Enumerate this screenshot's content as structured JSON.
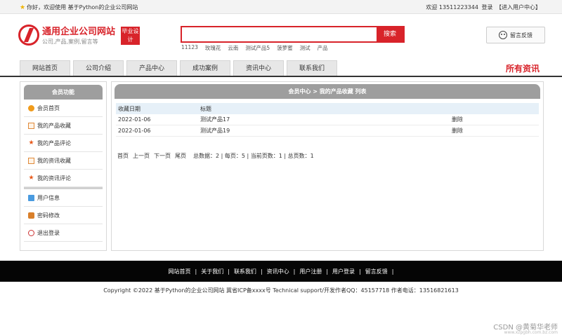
{
  "topbar": {
    "welcome": "你好，欢迎使用 基于Python的企业公司网站",
    "right_welcome": "欢迎 13511223344",
    "login": "登录",
    "user_center": "【进入用户中心】"
  },
  "header": {
    "logo_title": "通用企业公司网站",
    "logo_sub": "公司,产品,案例,留言等",
    "badge": "毕业设计",
    "search_placeholder": "",
    "search_button": "搜索",
    "hotwords": [
      "11123",
      "玫瑰花",
      "云南",
      "测试产品5",
      "菠萝蜜",
      "测试",
      "产品"
    ],
    "message_button": "留言反馈"
  },
  "nav": {
    "tabs": [
      "网站首页",
      "公司介绍",
      "产品中心",
      "成功案例",
      "资讯中心",
      "联系我们"
    ],
    "all_news": "所有资讯"
  },
  "sidebar": {
    "title": "会员功能",
    "items": [
      {
        "label": "会员首页",
        "icon": "home-icon"
      },
      {
        "label": "我的产品收藏",
        "icon": "document-icon"
      },
      {
        "label": "我的产品评论",
        "icon": "star-icon"
      },
      {
        "label": "我的资讯收藏",
        "icon": "document-icon"
      },
      {
        "label": "我的资讯评论",
        "icon": "star-icon"
      }
    ],
    "items2": [
      {
        "label": "用户信息",
        "icon": "user-icon"
      },
      {
        "label": "密码修改",
        "icon": "lock-icon"
      },
      {
        "label": "退出登录",
        "icon": "power-icon"
      }
    ]
  },
  "main": {
    "breadcrumb": "会员中心 > 我的产品收藏 列表",
    "columns": [
      "收藏日期",
      "标题",
      ""
    ],
    "rows": [
      {
        "date": "2022-01-06",
        "title": "测试产品17",
        "action": "删除"
      },
      {
        "date": "2022-01-06",
        "title": "测试产品19",
        "action": "删除"
      }
    ],
    "pager": {
      "first": "首页",
      "prev": "上一页",
      "next": "下一页",
      "last": "尾页",
      "summary": "总数据：2 | 每页：5 | 当前页数：1 | 总页数：1"
    }
  },
  "footer": {
    "links": [
      "网站首页",
      "关于我们",
      "联系我们",
      "资讯中心",
      "用户注册",
      "用户登录",
      "留言反馈"
    ],
    "copyright": "Copyright ©2022 基于Python的企业公司网站 冀省ICP备xxxx号    Technical support/开发作者QQ：45157718    作者电话：13516821613"
  },
  "watermark": "CSDN @黄菊华老师",
  "watermark_small": "www.xzpgbh.com.bz.com"
}
